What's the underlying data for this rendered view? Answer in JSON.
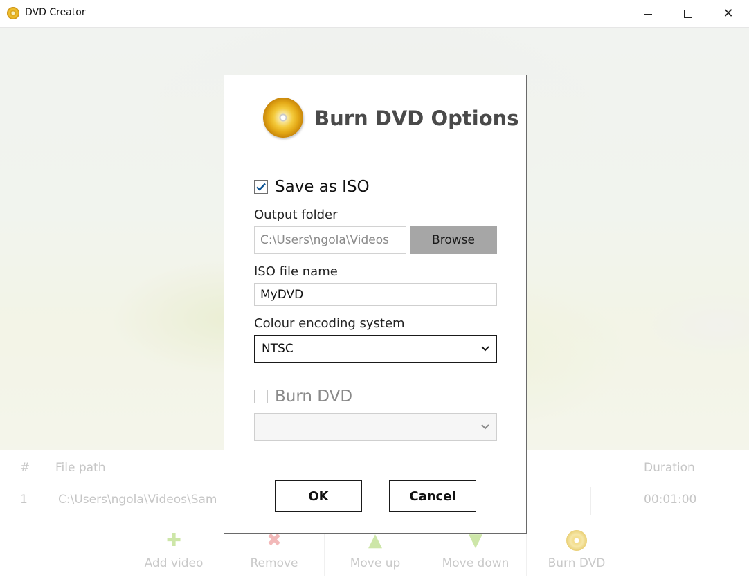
{
  "window": {
    "title": "DVD Creator",
    "controls": {
      "minimize": "minimize",
      "maximize": "maximize",
      "close": "✕"
    }
  },
  "table": {
    "headers": {
      "number": "#",
      "file_path": "File path",
      "duration": "Duration"
    },
    "rows": [
      {
        "number": "1",
        "file_path": "C:\\Users\\ngola\\Videos\\Sam",
        "duration": "00:01:00"
      }
    ]
  },
  "toolbar": {
    "add_video": "Add video",
    "remove": "Remove",
    "move_up": "Move up",
    "move_down": "Move down",
    "burn_dvd": "Burn DVD"
  },
  "dialog": {
    "title": "Burn DVD Options",
    "save_as_iso": {
      "label": "Save as ISO",
      "checked": true
    },
    "output_folder": {
      "label": "Output folder",
      "value": "C:\\Users\\ngola\\Videos"
    },
    "browse_label": "Browse",
    "iso_file_name": {
      "label": "ISO file name",
      "value": "MyDVD"
    },
    "colour_encoding": {
      "label": "Colour encoding system",
      "selected": "NTSC"
    },
    "burn_dvd": {
      "label": "Burn DVD",
      "checked": false,
      "enabled": false,
      "selected": ""
    },
    "ok_label": "OK",
    "cancel_label": "Cancel"
  },
  "colors": {
    "dialog_border": "#6a6a6a",
    "checkmark": "#0b5394",
    "browse_button": "#a6a6a6",
    "disabled_text": "#8a8a8a",
    "disc_gold": "#f3c93a"
  },
  "icons": {
    "app": "dvd-disc-icon",
    "dialog": "dvd-disc-icon",
    "add": "plus-icon",
    "remove": "x-icon",
    "move_up": "arrow-up-icon",
    "move_down": "arrow-down-icon",
    "burn": "dvd-disc-icon",
    "dropdown": "chevron-down-icon"
  }
}
